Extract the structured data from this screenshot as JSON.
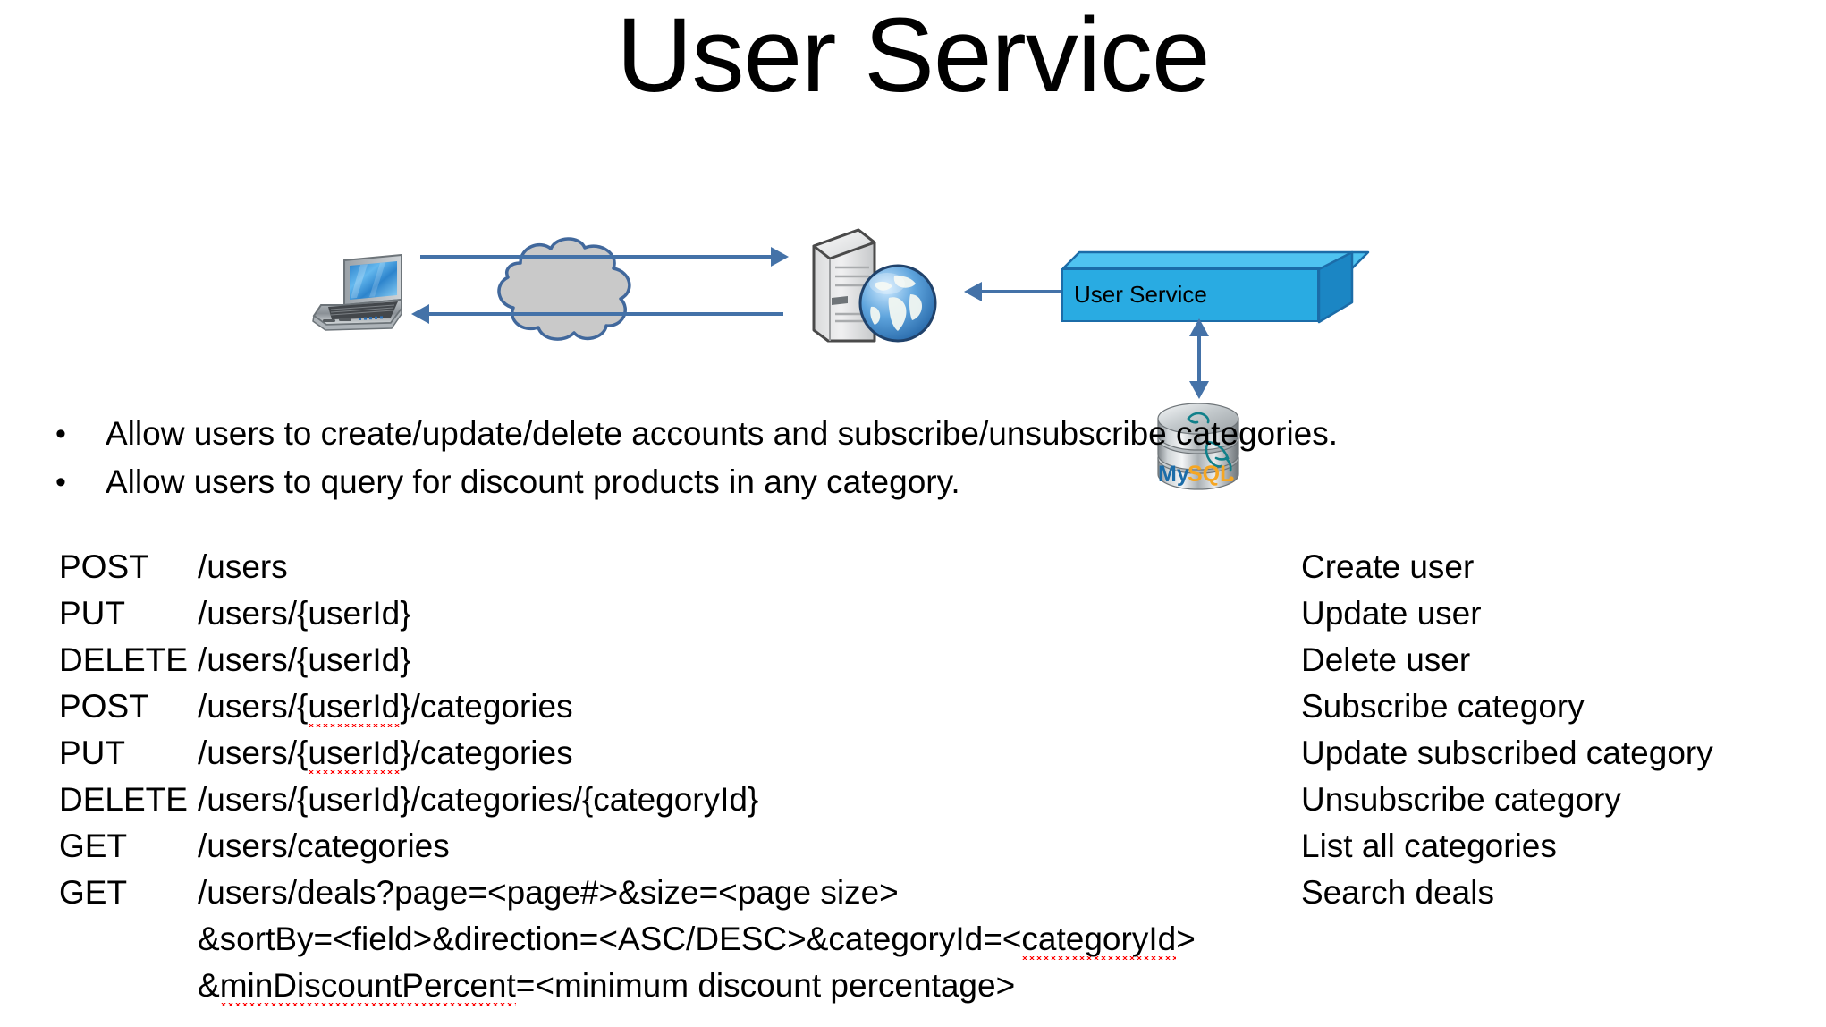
{
  "slide": {
    "title": "User Service"
  },
  "diagram": {
    "client_icon": "laptop-icon",
    "network_icon": "cloud-icon",
    "server_icon": "web-server-icon",
    "service_box_label": "User Service",
    "database_icon": "mysql-database-icon",
    "database_label": "MySQL",
    "arrow_client_to_server": "request-arrow",
    "arrow_server_to_client": "response-arrow",
    "arrow_server_to_service": "bidirectional-arrow",
    "arrow_service_to_database": "bidirectional-arrow",
    "colors": {
      "arrow": "#4472a8",
      "cloud_fill": "#c9c9c9",
      "cloud_stroke": "#41689c",
      "service_box_front": "#29abe2",
      "service_box_top": "#4fc3f0",
      "service_box_side": "#1b86c4",
      "service_box_stroke": "#1b6ca8",
      "spellcheck_underline": "#ff0000"
    }
  },
  "bullets": [
    {
      "marker": "•",
      "text": "Allow users to create/update/delete accounts and subscribe/unsubscribe categories."
    },
    {
      "marker": "•",
      "text": "Allow users to query for discount products in any category."
    }
  ],
  "api": {
    "rows": [
      {
        "method": "POST",
        "path_pre": "/users",
        "path_misspelled": "",
        "path_post": "",
        "description": "Create user"
      },
      {
        "method": "PUT",
        "path_pre": "/users/{userId}",
        "path_misspelled": "",
        "path_post": "",
        "description": "Update user"
      },
      {
        "method": "DELETE",
        "path_pre": "/users/{userId}",
        "path_misspelled": "",
        "path_post": "",
        "description": "Delete user"
      },
      {
        "method": "POST",
        "path_pre": "/users/{",
        "path_misspelled": "userId",
        "path_post": "}/categories",
        "description": "Subscribe category"
      },
      {
        "method": "PUT",
        "path_pre": "/users/{",
        "path_misspelled": "userId",
        "path_post": "}/categories",
        "description": "Update subscribed category"
      },
      {
        "method": "DELETE",
        "path_pre": "/users/{userId}/categories/{categoryId}",
        "path_misspelled": "",
        "path_post": "",
        "description": "Unsubscribe category"
      },
      {
        "method": "GET",
        "path_pre": "/users/categories",
        "path_misspelled": "",
        "path_post": "",
        "description": "List all categories"
      },
      {
        "method": "GET",
        "path_pre": "/users/deals?page=<page#>&size=<page size>",
        "path_misspelled": "",
        "path_post": "",
        "description": "Search deals"
      }
    ],
    "continuations": [
      {
        "pre": "&sortBy=<field>&direction=<ASC/DESC>&categoryId=<",
        "misspelled": "categoryId",
        "post": ">"
      },
      {
        "pre": "&",
        "misspelled": "minDiscountPercent",
        "post": "=<minimum discount percentage>"
      }
    ]
  }
}
